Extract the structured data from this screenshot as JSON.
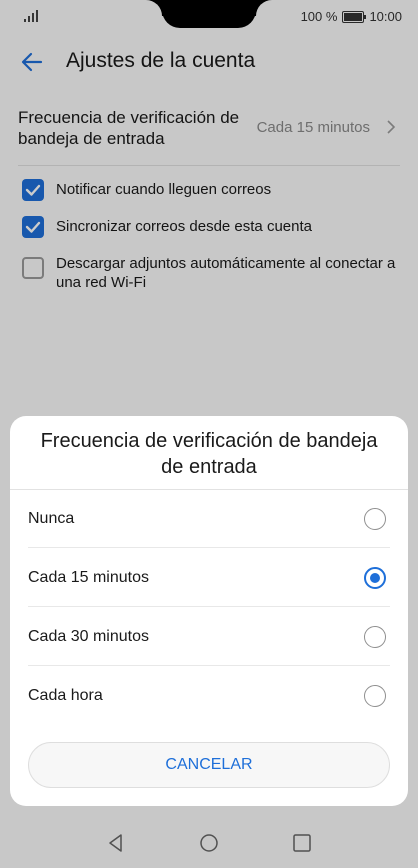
{
  "status_bar": {
    "battery_text": "100 %",
    "time": "10:00"
  },
  "header": {
    "title": "Ajustes de la cuenta"
  },
  "settings": {
    "sync_frequency": {
      "label": "Frecuencia de verificación de bandeja de entrada",
      "value": "Cada 15 minutos"
    },
    "checkboxes": [
      {
        "label": "Notificar cuando lleguen correos",
        "checked": true
      },
      {
        "label": "Sincronizar correos desde esta cuenta",
        "checked": true
      },
      {
        "label": "Descargar adjuntos automáticamente al conectar a una red Wi-Fi",
        "checked": false
      }
    ]
  },
  "dialog": {
    "title": "Frecuencia de verificación de bandeja de entrada",
    "options": [
      {
        "label": "Nunca",
        "selected": false
      },
      {
        "label": "Cada 15 minutos",
        "selected": true
      },
      {
        "label": "Cada 30 minutos",
        "selected": false
      },
      {
        "label": "Cada hora",
        "selected": false
      }
    ],
    "cancel_label": "CANCELAR"
  },
  "colors": {
    "accent": "#1e6fd9",
    "overlay": "rgba(0,0,0,0.2)"
  },
  "icons": {
    "back": "back-arrow-icon",
    "chevron": "chevron-right-icon",
    "nav_back": "nav-back-icon",
    "nav_home": "nav-home-icon",
    "nav_recents": "nav-recents-icon"
  }
}
